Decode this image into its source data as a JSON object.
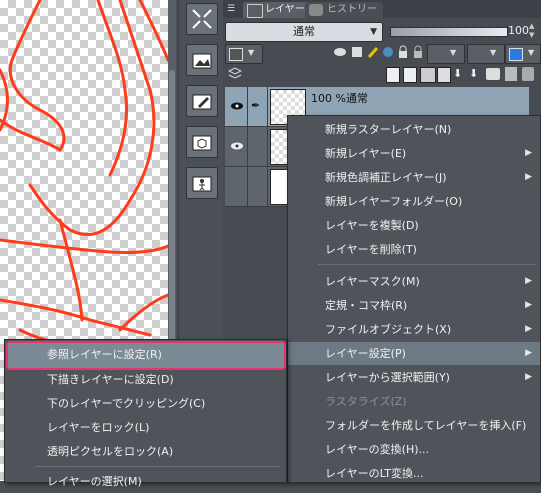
{
  "tabs": [
    {
      "label": "レイヤー",
      "active": true
    },
    {
      "label": "ヒストリー",
      "active": false
    }
  ],
  "blend_mode": "通常",
  "opacity": "100",
  "layers": [
    {
      "name": "100 %通常",
      "selected": true,
      "visible": true
    },
    {
      "name": "",
      "selected": false,
      "visible": true
    },
    {
      "name": "",
      "selected": false,
      "visible": false
    }
  ],
  "main_menu": {
    "items": [
      {
        "label": "新規ラスターレイヤー(N)",
        "submenu": false,
        "disabled": false
      },
      {
        "label": "新規レイヤー(E)",
        "submenu": true,
        "disabled": false
      },
      {
        "label": "新規色調補正レイヤー(J)",
        "submenu": true,
        "disabled": false
      },
      {
        "label": "新規レイヤーフォルダー(O)",
        "submenu": false,
        "disabled": false
      },
      {
        "label": "レイヤーを複製(D)",
        "submenu": false,
        "disabled": false
      },
      {
        "label": "レイヤーを削除(T)",
        "submenu": false,
        "disabled": false
      },
      {
        "label": "レイヤーマスク(M)",
        "submenu": true,
        "disabled": false
      },
      {
        "label": "定規・コマ枠(R)",
        "submenu": true,
        "disabled": false
      },
      {
        "label": "ファイルオブジェクト(X)",
        "submenu": true,
        "disabled": false
      },
      {
        "label": "レイヤー設定(P)",
        "submenu": true,
        "disabled": false,
        "highlighted": true
      },
      {
        "label": "レイヤーから選択範囲(Y)",
        "submenu": true,
        "disabled": false
      },
      {
        "label": "ラスタライズ(Z)",
        "submenu": false,
        "disabled": true
      },
      {
        "label": "フォルダーを作成してレイヤーを挿入(F)",
        "submenu": false,
        "disabled": false
      },
      {
        "label": "レイヤーの変換(H)...",
        "submenu": false,
        "disabled": false
      },
      {
        "label": "レイヤーのLT変換...",
        "submenu": false,
        "disabled": false
      }
    ]
  },
  "sub_menu": {
    "items": [
      {
        "label": "参照レイヤーに設定(R)",
        "highlighted": true
      },
      {
        "label": "下描きレイヤーに設定(D)"
      },
      {
        "label": "下のレイヤーでクリッピング(C)"
      },
      {
        "label": "レイヤーをロック(L)"
      },
      {
        "label": "透明ピクセルをロック(A)"
      },
      {
        "label": "レイヤーの選択(M)"
      }
    ]
  },
  "colors": {
    "highlight_outline": "#e8336f",
    "stroke_red": "#ff3b1a",
    "selected_layer": "#8fa4b4"
  }
}
